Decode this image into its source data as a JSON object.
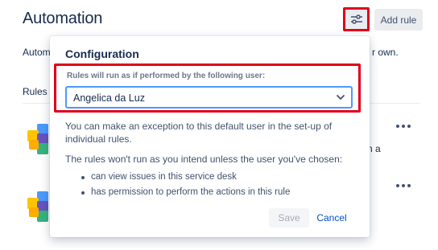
{
  "header": {
    "title": "Automation",
    "settings_icon": "sliders-icon",
    "add_rule_label": "Add rule"
  },
  "background": {
    "description_left": "Autom",
    "description_right": "r own.",
    "rules_label": "Rules i",
    "row_text_right": "n a",
    "more_icon": "ellipsis-icon"
  },
  "popover": {
    "title": "Configuration",
    "select": {
      "label": "Rules will run as if performed by the following user:",
      "value": "Angelica da Luz",
      "chevron_icon": "chevron-down-icon"
    },
    "paragraph1": "You can make an exception to this default user in the set-up of individual rules.",
    "paragraph2": "The rules won't run as you intend unless the user you've chosen:",
    "bullets": [
      "can view issues in this service desk",
      "has permission to perform the actions in this rule"
    ],
    "save_label": "Save",
    "cancel_label": "Cancel"
  },
  "colors": {
    "highlight": "#e2001a",
    "focus_border": "#4c9aff",
    "link": "#0052cc",
    "text_primary": "#172b4d",
    "text_secondary": "#42526e"
  }
}
